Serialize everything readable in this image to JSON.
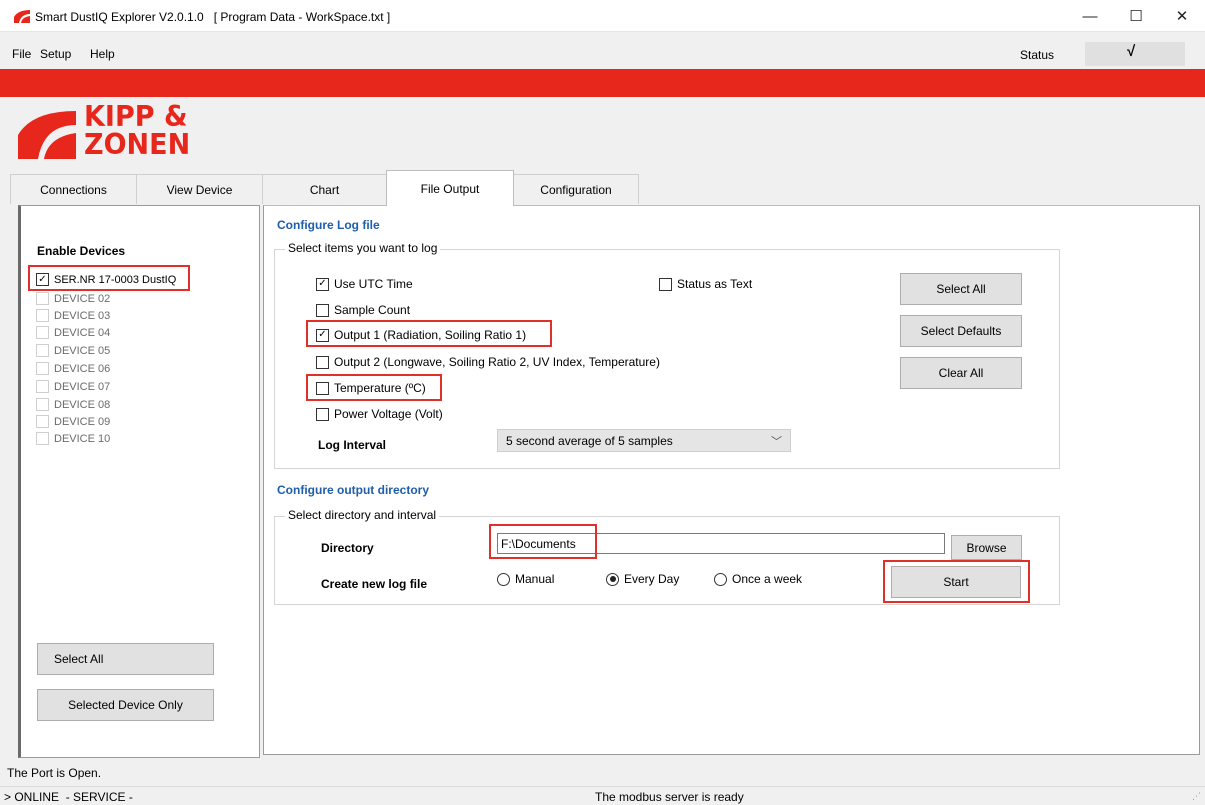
{
  "window": {
    "title": "Smart DustIQ Explorer V2.0.1.0   [ Program Data - WorkSpace.txt ]",
    "minimize_glyph": "—",
    "maximize_glyph": "☐",
    "close_glyph": "✕"
  },
  "menu": {
    "file": "File",
    "setup": "Setup",
    "help": "Help",
    "status_label": "Status",
    "status_value": "√"
  },
  "logo": {
    "line1": "KIPP &",
    "line2": "ZONEN"
  },
  "tabs": [
    {
      "label": "Connections"
    },
    {
      "label": "View Device"
    },
    {
      "label": "Chart"
    },
    {
      "label": "File Output"
    },
    {
      "label": "Configuration"
    }
  ],
  "left": {
    "heading": "Enable Devices",
    "devices": [
      {
        "label": "SER.NR 17-0003 DustIQ",
        "checked": true,
        "enabled": true
      },
      {
        "label": "DEVICE 02",
        "checked": false,
        "enabled": false
      },
      {
        "label": "DEVICE 03",
        "checked": false,
        "enabled": false
      },
      {
        "label": "DEVICE 04",
        "checked": false,
        "enabled": false
      },
      {
        "label": "DEVICE 05",
        "checked": false,
        "enabled": false
      },
      {
        "label": "DEVICE 06",
        "checked": false,
        "enabled": false
      },
      {
        "label": "DEVICE 07",
        "checked": false,
        "enabled": false
      },
      {
        "label": "DEVICE 08",
        "checked": false,
        "enabled": false
      },
      {
        "label": "DEVICE 09",
        "checked": false,
        "enabled": false
      },
      {
        "label": "DEVICE 10",
        "checked": false,
        "enabled": false
      }
    ],
    "select_all": "Select All",
    "selected_only": "Selected Device Only"
  },
  "log": {
    "heading": "Configure Log file",
    "group_title": "Select items you want to log",
    "items": {
      "utc": {
        "label": "Use UTC Time",
        "checked": true
      },
      "status_text": {
        "label": "Status as Text",
        "checked": false
      },
      "sample_count": {
        "label": "Sample Count",
        "checked": false
      },
      "output1": {
        "label": "Output 1 (Radiation, Soiling Ratio 1)",
        "checked": true
      },
      "output2": {
        "label": "Output 2 (Longwave, Soiling Ratio 2, UV Index, Temperature)",
        "checked": false
      },
      "temperature": {
        "label": "Temperature (ºC)",
        "checked": false
      },
      "power": {
        "label": "Power Voltage (Volt)",
        "checked": false
      }
    },
    "interval_label": "Log Interval",
    "interval_value": "5 second average of 5 samples",
    "select_all": "Select All",
    "select_defaults": "Select Defaults",
    "clear_all": "Clear All"
  },
  "output": {
    "heading": "Configure output directory",
    "group_title": "Select directory and interval",
    "directory_label": "Directory",
    "directory_value": "F:\\Documents",
    "browse": "Browse",
    "new_file_label": "Create new log file",
    "options": [
      "Manual",
      "Every Day",
      "Once a week"
    ],
    "selected_option": "Every Day",
    "start": "Start"
  },
  "status": {
    "line1": "The Port is Open.",
    "line2_left": "> ONLINE  - SERVICE -",
    "line2_center": "The modbus server is ready"
  },
  "colors": {
    "brand_red": "#e8271c",
    "heading_blue": "#1f5ea8",
    "highlight_red": "#e0302a"
  }
}
